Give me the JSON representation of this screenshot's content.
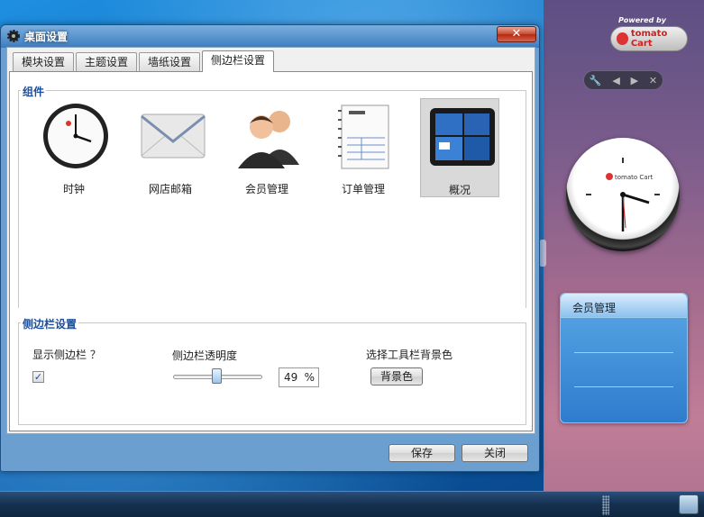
{
  "window": {
    "title": "桌面设置",
    "close_glyph": "✕"
  },
  "tabs": [
    "模块设置",
    "主题设置",
    "墙纸设置",
    "侧边栏设置"
  ],
  "components": {
    "group_label": "组件",
    "items": [
      {
        "label": "时钟",
        "icon": "clock-icon"
      },
      {
        "label": "网店邮箱",
        "icon": "mail-icon"
      },
      {
        "label": "会员管理",
        "icon": "users-icon"
      },
      {
        "label": "订单管理",
        "icon": "orders-icon"
      },
      {
        "label": "概况",
        "icon": "overview-icon",
        "selected": true
      }
    ]
  },
  "sidebar_settings": {
    "group_label": "侧边栏设置",
    "show_sidebar_label": "显示侧边栏 ？",
    "show_sidebar_checked": "✓",
    "opacity_label": "侧边栏透明度",
    "opacity_value": "49",
    "opacity_unit": "%",
    "opacity_fraction": 0.49,
    "toolbar_bg_label": "选择工具栏背景色",
    "bg_color_button": "背景色"
  },
  "footer": {
    "save": "保存",
    "close": "关闭"
  },
  "sidebar_panel": {
    "powered_by": "Powered by",
    "brand_logo": "tomato Cart",
    "gadget_title": "会员管理"
  }
}
